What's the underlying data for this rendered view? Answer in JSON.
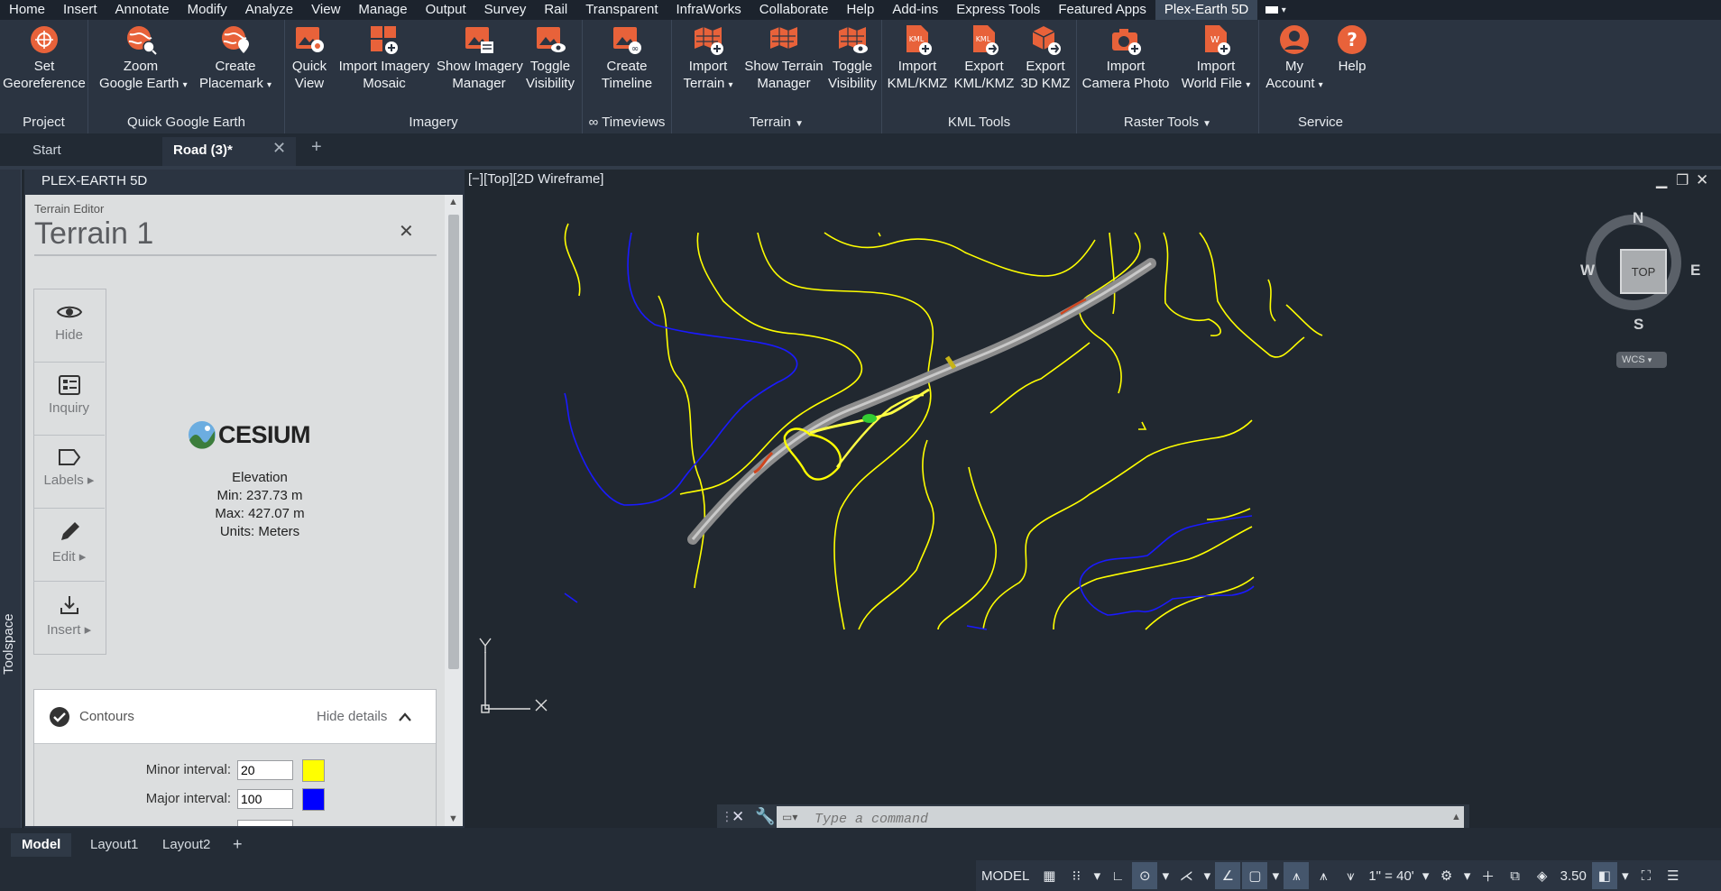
{
  "menu": {
    "items": [
      "Home",
      "Insert",
      "Annotate",
      "Modify",
      "Analyze",
      "View",
      "Manage",
      "Output",
      "Survey",
      "Rail",
      "Transparent",
      "InfraWorks",
      "Collaborate",
      "Help",
      "Add-ins",
      "Express Tools",
      "Featured Apps",
      "Plex-Earth 5D"
    ],
    "active": "Plex-Earth 5D"
  },
  "ribbon": {
    "project": {
      "title": "Project",
      "set_georeference": [
        "Set",
        "Georeference"
      ]
    },
    "quick_google_earth": {
      "title": "Quick Google Earth",
      "zoom": [
        "Zoom",
        "Google Earth"
      ],
      "placemark": [
        "Create",
        "Placemark"
      ]
    },
    "imagery": {
      "title": "Imagery",
      "quick_view": [
        "Quick",
        "View"
      ],
      "import_mosaic": [
        "Import Imagery",
        "Mosaic"
      ],
      "show_manager": [
        "Show Imagery",
        "Manager"
      ],
      "toggle": [
        "Toggle",
        "Visibility"
      ]
    },
    "timeviews": {
      "title": "∞ Timeviews",
      "create_timeline": [
        "Create",
        "Timeline"
      ]
    },
    "terrain": {
      "title": "Terrain",
      "import": [
        "Import",
        "Terrain"
      ],
      "show_manager": [
        "Show Terrain",
        "Manager"
      ],
      "toggle": [
        "Toggle",
        "Visibility"
      ]
    },
    "kml_tools": {
      "title": "KML Tools",
      "import": [
        "Import",
        "KML/KMZ"
      ],
      "export": [
        "Export",
        "KML/KMZ"
      ],
      "export3d": [
        "Export",
        "3D KMZ"
      ]
    },
    "raster_tools": {
      "title": "Raster Tools",
      "camera": [
        "Import",
        "Camera Photo"
      ],
      "world_file": [
        "Import",
        "World File"
      ]
    },
    "service": {
      "title": "Service",
      "account": [
        "My",
        "Account"
      ],
      "help": [
        "Help"
      ]
    }
  },
  "doc_tabs": {
    "start": "Start",
    "active": "Road (3)*"
  },
  "toolspace_label": "Toolspace",
  "palette": {
    "title": "PLEX-EARTH 5D",
    "editor_caption": "Terrain Editor",
    "terrain_name": "Terrain 1",
    "side_buttons": [
      {
        "label": "Hide"
      },
      {
        "label": "Inquiry"
      },
      {
        "label": "Labels ▸"
      },
      {
        "label": "Edit ▸"
      },
      {
        "label": "Insert ▸"
      }
    ],
    "provider": "CESIUM",
    "elevation": {
      "heading": "Elevation",
      "min": "Min: 237.73 m",
      "max": "Max: 427.07 m",
      "units": "Units: Meters"
    },
    "contours": {
      "title": "Contours",
      "toggle": "Hide details",
      "minor_label": "Minor interval:",
      "minor_value": "20",
      "minor_color": "#ffff00",
      "major_label": "Major interval:",
      "major_value": "100",
      "major_color": "#0000ff"
    }
  },
  "viewport": {
    "label": "[−][Top][2D Wireframe]",
    "viewcube": {
      "n": "N",
      "s": "S",
      "e": "E",
      "w": "W",
      "top": "TOP",
      "wcs": "WCS"
    },
    "ucs": {
      "x": "X",
      "y": "Y"
    }
  },
  "command": {
    "placeholder": "Type a command"
  },
  "layout_tabs": [
    "Model",
    "Layout1",
    "Layout2"
  ],
  "status": {
    "model": "MODEL",
    "scale": "1\" = 40'",
    "value": "3.50"
  },
  "colors": {
    "accent": "#e8623a",
    "minor_contour": "#ffff00",
    "major_contour": "#0000ff",
    "road": "#9a9a9a"
  }
}
